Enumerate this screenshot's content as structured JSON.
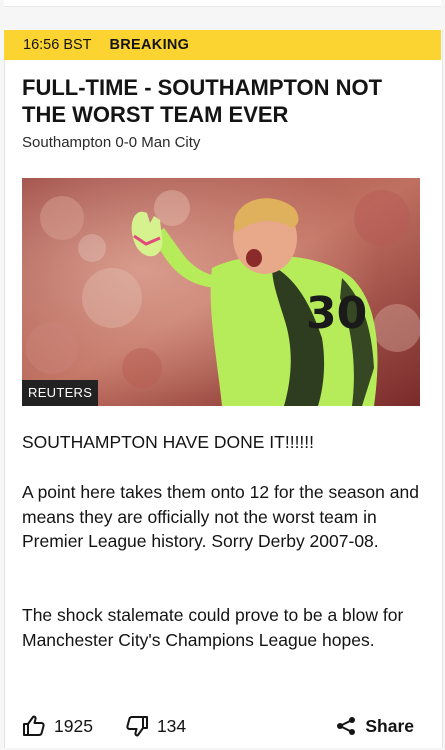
{
  "post": {
    "time": "16:56 BST",
    "tag": "BREAKING",
    "headline": "FULL-TIME - SOUTHAMPTON NOT THE WORST TEAM EVER",
    "subhead": "Southampton 0-0 Man City",
    "image": {
      "credit": "REUTERS",
      "shirt_number": "30"
    },
    "paragraphs": [
      "SOUTHAMPTON HAVE DONE IT!!!!!!",
      "A point here takes them onto 12 for the season and means they are officially not the worst team in Premier League history. Sorry Derby 2007-08.",
      "The shock stalemate could prove to be a blow for Manchester City's Champions League hopes."
    ]
  },
  "reactions": {
    "like_icon": "thumbs-up-icon",
    "likes": "1925",
    "dislike_icon": "thumbs-down-icon",
    "dislikes": "134",
    "share_icon": "share-icon",
    "share_label": "Share"
  },
  "colors": {
    "breaking_banner": "#fbd431",
    "text": "#141414",
    "kit": "#b6ec5a"
  }
}
